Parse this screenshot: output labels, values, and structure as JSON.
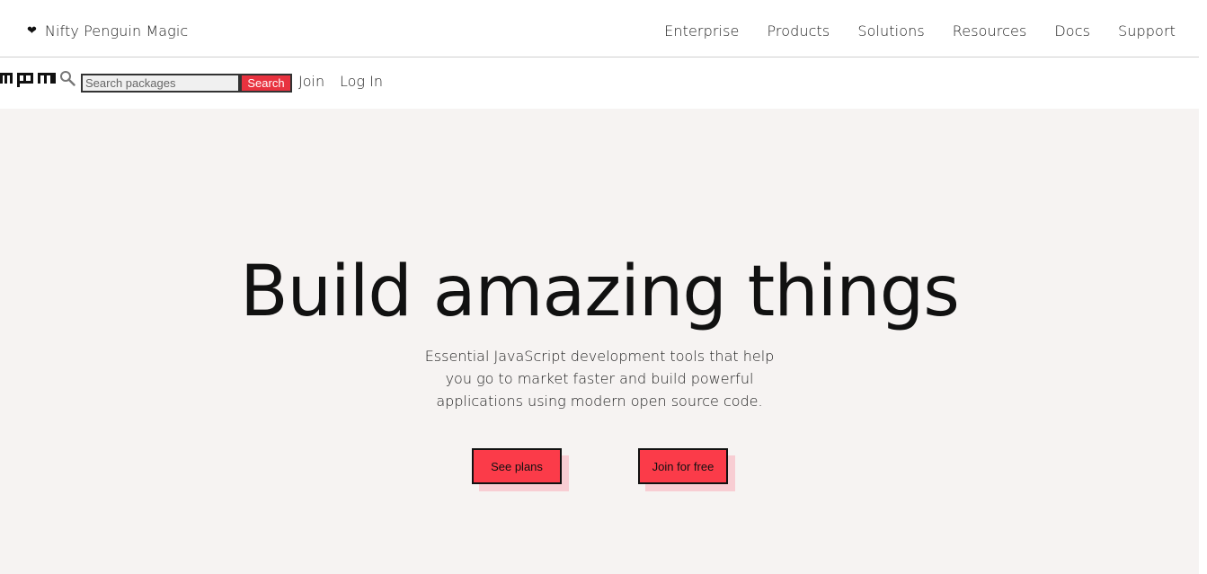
{
  "topbar": {
    "brand_icon": "heart-icon",
    "brand_text": "Nifty Penguin Magic",
    "nav": [
      "Enterprise",
      "Products",
      "Solutions",
      "Resources",
      "Docs",
      "Support"
    ]
  },
  "searchbar": {
    "logo": "npm",
    "search_icon": "magnifier-icon",
    "placeholder": "Search packages",
    "value": "",
    "button_label": "Search",
    "join_label": "Join",
    "login_label": "Log In"
  },
  "hero": {
    "title": "Build amazing things",
    "subtitle": "Essential JavaScript development tools that help you go to market faster and build powerful applications using modern open source code.",
    "primary_cta": "See plans",
    "secondary_cta": "Join for free"
  },
  "colors": {
    "accent": "#fb3b49",
    "search_button": "#e8323f",
    "cta_shadow": "#f8cdd3",
    "hero_background": "#f6f3f2"
  }
}
